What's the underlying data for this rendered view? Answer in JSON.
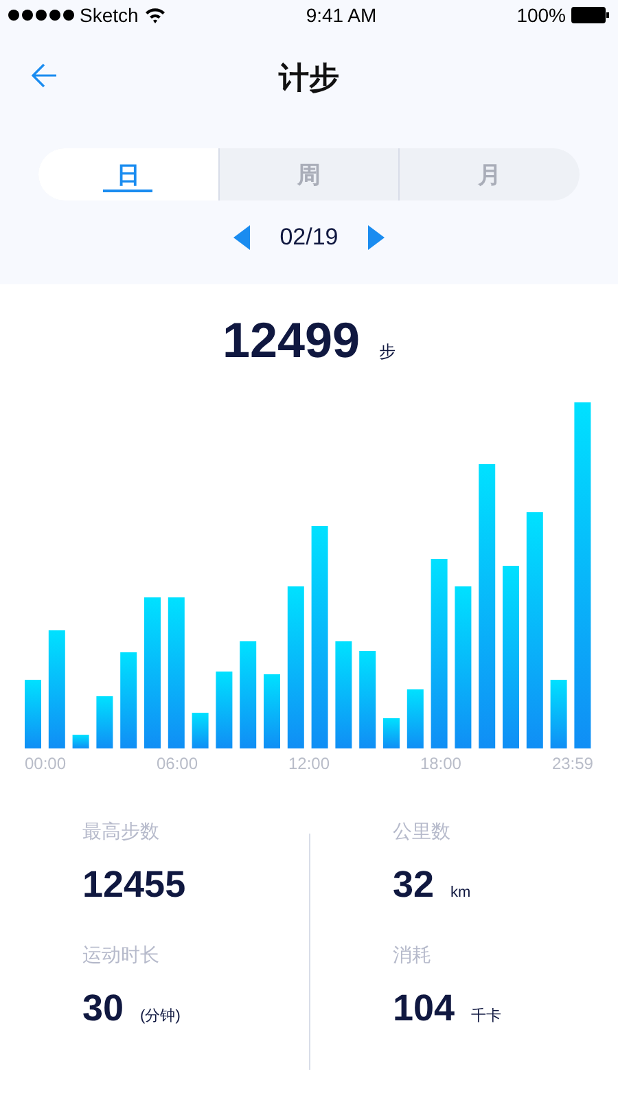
{
  "status_bar": {
    "carrier": "Sketch",
    "time": "9:41 AM",
    "battery": "100%"
  },
  "header": {
    "title": "计步"
  },
  "tabs": [
    {
      "label": "日",
      "selected": true
    },
    {
      "label": "周",
      "selected": false
    },
    {
      "label": "月",
      "selected": false
    }
  ],
  "date": "02/19",
  "total": {
    "value": "12499",
    "unit": "步"
  },
  "chart": {
    "x_labels": [
      "00:00",
      "06:00",
      "12:00",
      "18:00",
      "23:59"
    ]
  },
  "stats": [
    {
      "label": "最高步数",
      "value": "12455"
    },
    {
      "label": "公里数",
      "value": "32",
      "unit": "km"
    },
    {
      "label": "运动时长",
      "value": "30",
      "unit": "(分钟)"
    },
    {
      "label": "消耗",
      "value": "104",
      "unit": "千卡"
    }
  ]
}
